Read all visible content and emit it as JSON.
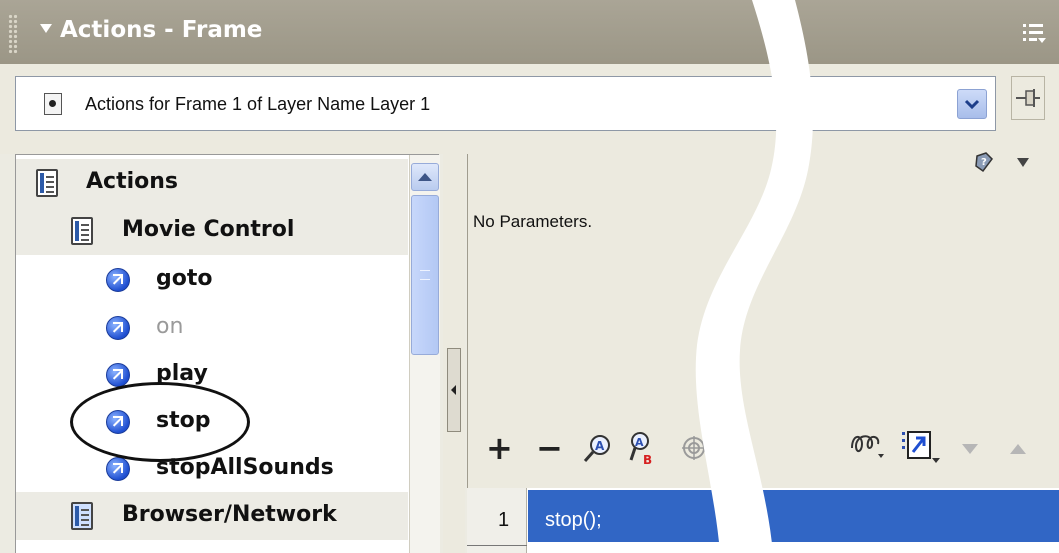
{
  "panel": {
    "title": "Actions - Frame"
  },
  "selector": {
    "text": "Actions for Frame 1 of Layer Name Layer 1"
  },
  "toolbox": {
    "items": [
      {
        "label": "Actions",
        "type": "book",
        "level": 0
      },
      {
        "label": "Movie Control",
        "type": "book",
        "level": 1
      },
      {
        "label": "goto",
        "type": "action",
        "level": 2
      },
      {
        "label": "on",
        "type": "action",
        "level": 2,
        "disabled": true
      },
      {
        "label": "play",
        "type": "action",
        "level": 2
      },
      {
        "label": "stop",
        "type": "action",
        "level": 2
      },
      {
        "label": "stopAllSounds",
        "type": "action",
        "level": 2
      },
      {
        "label": "Browser/Network",
        "type": "book",
        "level": 1
      }
    ]
  },
  "parameters": {
    "message": "No Parameters."
  },
  "script_toolbar": {
    "add_label": "+",
    "remove_label": "−"
  },
  "script": {
    "lines": [
      {
        "number": "1",
        "code": "stop();"
      }
    ]
  },
  "colors": {
    "titlebar": "#9b9686",
    "selection": "#3166c5",
    "panel_bg": "#eceadf"
  }
}
